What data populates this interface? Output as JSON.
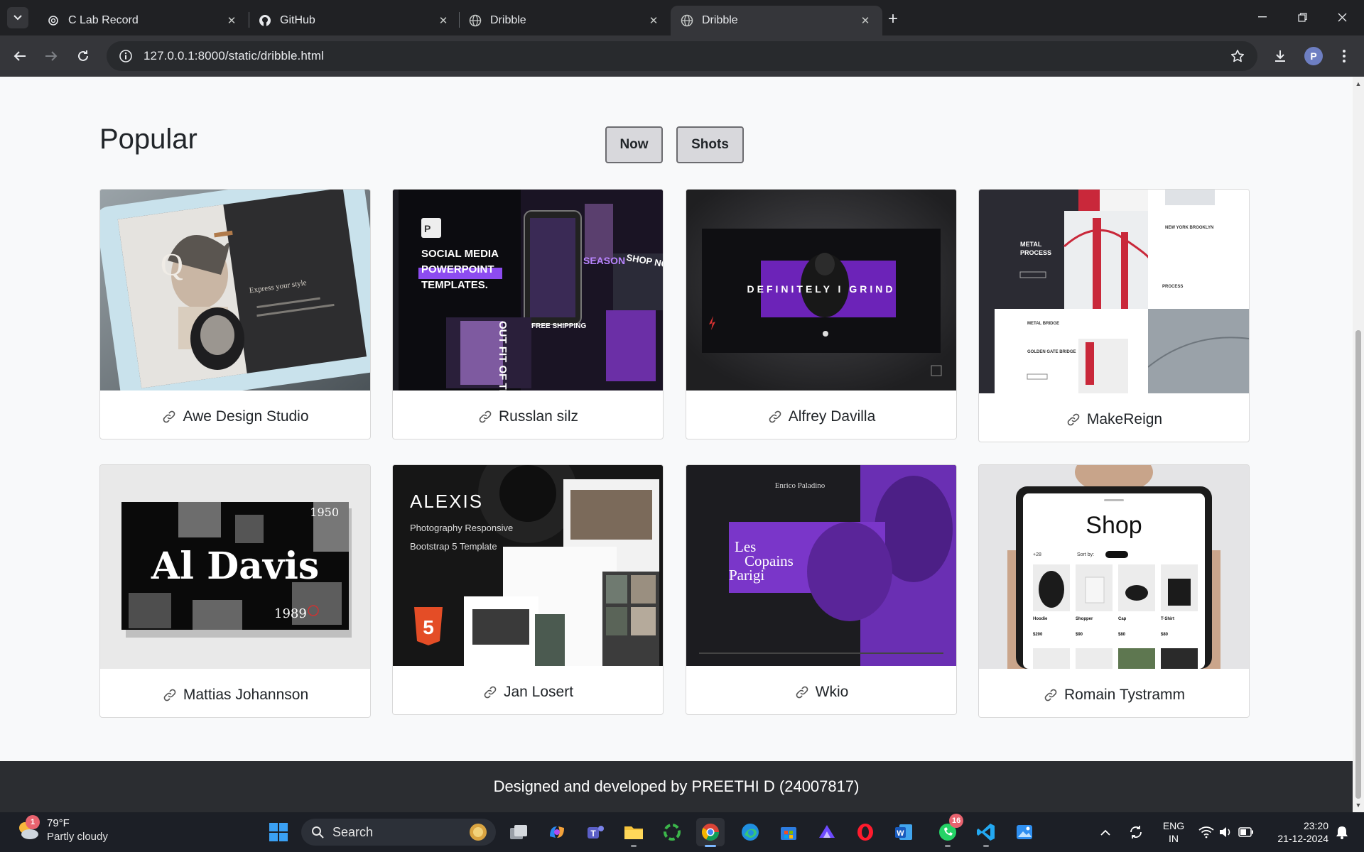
{
  "browser": {
    "tabs": [
      {
        "title": "C Lab Record",
        "icon": "openai-icon",
        "active": false
      },
      {
        "title": "GitHub",
        "icon": "github-icon",
        "active": false
      },
      {
        "title": "Dribble",
        "icon": "globe-icon",
        "active": false
      },
      {
        "title": "Dribble",
        "icon": "globe-icon",
        "active": true
      }
    ],
    "url": "127.0.0.1:8000/static/dribble.html",
    "profile_initial": "P"
  },
  "page": {
    "heading": "Popular",
    "filters": [
      "Now",
      "Shots"
    ],
    "cards": [
      {
        "name": "Awe Design Studio",
        "thumb": "tablet-portfolio-mockup"
      },
      {
        "name": "Russlan silz",
        "thumb": "social-media-powerpoint-templates"
      },
      {
        "name": "Alfrey Davilla",
        "thumb": "definitely-i-grind-site"
      },
      {
        "name": "MakeReign",
        "thumb": "metal-process-bridge-site"
      },
      {
        "name": "Mattias Johannson",
        "thumb": "al-davis-collage"
      },
      {
        "name": "Jan Losert",
        "thumb": "alexis-photography-template"
      },
      {
        "name": "Wkio",
        "thumb": "les-copains-parigi"
      },
      {
        "name": "Romain Tystramm",
        "thumb": "shop-tablet-mockup"
      }
    ],
    "thumb_text": {
      "social": [
        "SOCIAL MEDIA",
        "POWERPOINT",
        "TEMPLATES."
      ],
      "social_extra": [
        "SEASON",
        "SHOP NOW",
        "FREE SHIPPING",
        "OUT FIT OF THE DAY"
      ],
      "grind": "DEFINITELY I GRIND",
      "metal_title": [
        "METAL",
        "PROCESS"
      ],
      "metal_extra": [
        "NEW YORK BROOKLYN",
        "PROCESS",
        "METAL BRIDGE",
        "GOLDEN GATE BRIDGE"
      ],
      "davis": "Al Davis",
      "davis_years": [
        "1950",
        "1989"
      ],
      "alexis_title": "ALEXIS",
      "alexis_sub": [
        "Photography Responsive",
        "Bootstrap 5 Template"
      ],
      "alexis_badge": "5",
      "copains": [
        "Les",
        "Copains",
        "Parigi"
      ],
      "copains_author": "Enrico Paladino",
      "shop_title": "Shop",
      "shop_items": [
        "Hoodie",
        "Shopper",
        "Cap",
        "T-Shirt"
      ],
      "shop_prices": [
        "$200",
        "$90",
        "$80",
        "$80"
      ],
      "shop_sort": "Sort by:",
      "shop_count": "+28"
    },
    "footer": "Designed and developed by PREETHI D (24007817)"
  },
  "taskbar": {
    "weather_temp": "79°F",
    "weather_desc": "Partly cloudy",
    "weather_badge": "1",
    "search_placeholder": "Search",
    "whatsapp_badge": "16",
    "lang_line1": "ENG",
    "lang_line2": "IN",
    "time": "23:20",
    "date": "21-12-2024"
  }
}
